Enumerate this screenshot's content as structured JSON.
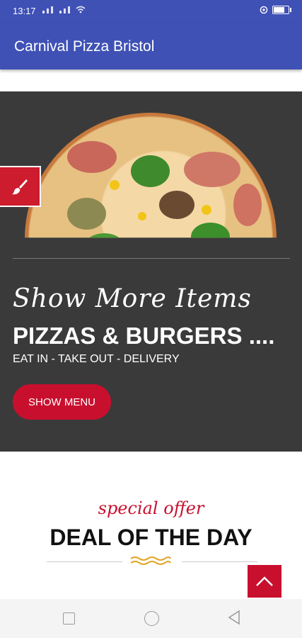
{
  "status_bar": {
    "time": "13:17",
    "icons": [
      "signal-icon",
      "signal-icon",
      "wifi-icon",
      "alarm-icon",
      "battery-icon"
    ]
  },
  "app_bar": {
    "title": "Carnival Pizza Bristol"
  },
  "hero": {
    "script_text": "Show More Items",
    "headline": "PIZZAS & BURGERS ....",
    "subline": "EAT IN - TAKE OUT - DELIVERY",
    "button_label": "SHOW MENU",
    "image": "pizza-image",
    "side_tab_icon": "paint-brush-icon"
  },
  "offer": {
    "script_text": "special offer",
    "title": "DEAL OF THE DAY"
  },
  "scroll_top_icon": "chevron-up-icon",
  "navigation": {
    "buttons": [
      "recent-apps",
      "home",
      "back"
    ]
  },
  "colors": {
    "primary": "#3f51b5",
    "accent": "#c8102e",
    "hero_bg": "#3a3a3a"
  }
}
